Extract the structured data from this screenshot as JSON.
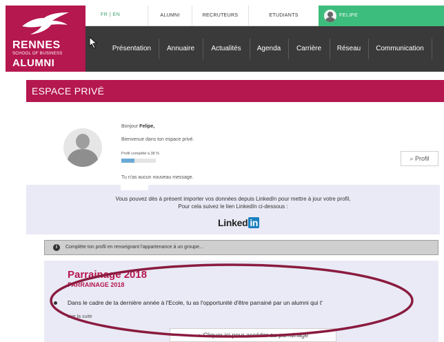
{
  "colors": {
    "brand": "#b5174f",
    "nav_bg": "#3a3a3a",
    "user_tab": "#3dbd7d",
    "panel": "#e9eaf5",
    "annotation": "#8a1b3f"
  },
  "logo": {
    "name": "RENNES",
    "subtitle": "SCHOOL OF BUSINESS",
    "alumni": "ALUMNI"
  },
  "topbar": {
    "lang": "FR | EN",
    "links": [
      "ALUMNI",
      "RECRUTEURS",
      "ETUDIANTS"
    ],
    "user": "FELIPE"
  },
  "nav": {
    "items": [
      "Présentation",
      "Annuaire",
      "Actualités",
      "Agenda",
      "Carrière",
      "Réseau",
      "Communication"
    ]
  },
  "banner": {
    "title": "ESPACE PRIVÉ"
  },
  "welcome": {
    "greeting_prefix": "Bonjour ",
    "user_name": "Felipe,",
    "subtitle": "Bienvenue dans ton espace privé.",
    "profile_progress_label": "Profil complété à 38 %",
    "profile_progress": 38,
    "messages": "Tu n'as aucun nouveau message.",
    "profil_button": "Profil"
  },
  "linkedin": {
    "line1": "Vous pouvez dès à présent importer vos données depuis LinkedIn pour mettre à jour votre profil,",
    "line2": "Pour cela suivez le lien LinkedIn ci-dessous :",
    "logo_text": "Linked",
    "logo_in": "in"
  },
  "alert": {
    "text": "Complète ton profil en renseignant l'appartenance à un groupe..."
  },
  "parrainage": {
    "title": "Parrainage 2018",
    "subtitle": "PARRAINAGE 2018",
    "text": "Dans le cadre de ta dernière année à l'Ecole, tu as l'opportunité d'être parrainé par un alumni qui t'",
    "more": "Lire la suite",
    "button": "Cliquer ici pour accéder au parrainage"
  }
}
